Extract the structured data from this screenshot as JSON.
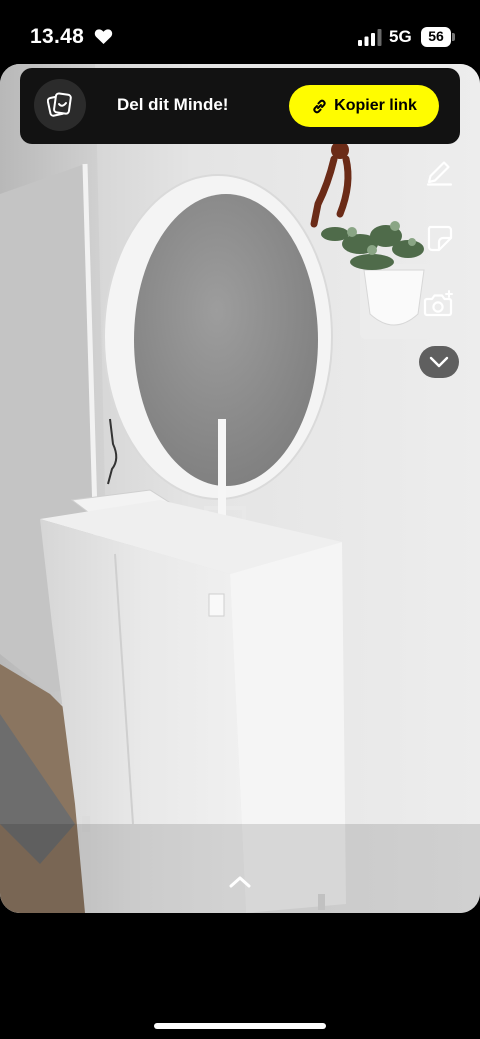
{
  "status_bar": {
    "time": "13.48",
    "network": "5G",
    "battery": "56",
    "icons": [
      "heart-icon",
      "signal-icon",
      "battery-icon"
    ]
  },
  "share_banner": {
    "icon": "memory-share-icon",
    "text": "Del dit Minde!",
    "button_label": "Kopier link",
    "button_icon": "link-icon",
    "button_color": "#fffc00"
  },
  "side_tools": [
    "pencil-icon",
    "sticker-icon",
    "camera-icon",
    "chevron-down-icon"
  ],
  "bottom": {
    "expand_icon": "chevron-up-icon"
  },
  "colors": {
    "background": "#000000",
    "banner": "#121212",
    "accent": "#fffc00"
  }
}
